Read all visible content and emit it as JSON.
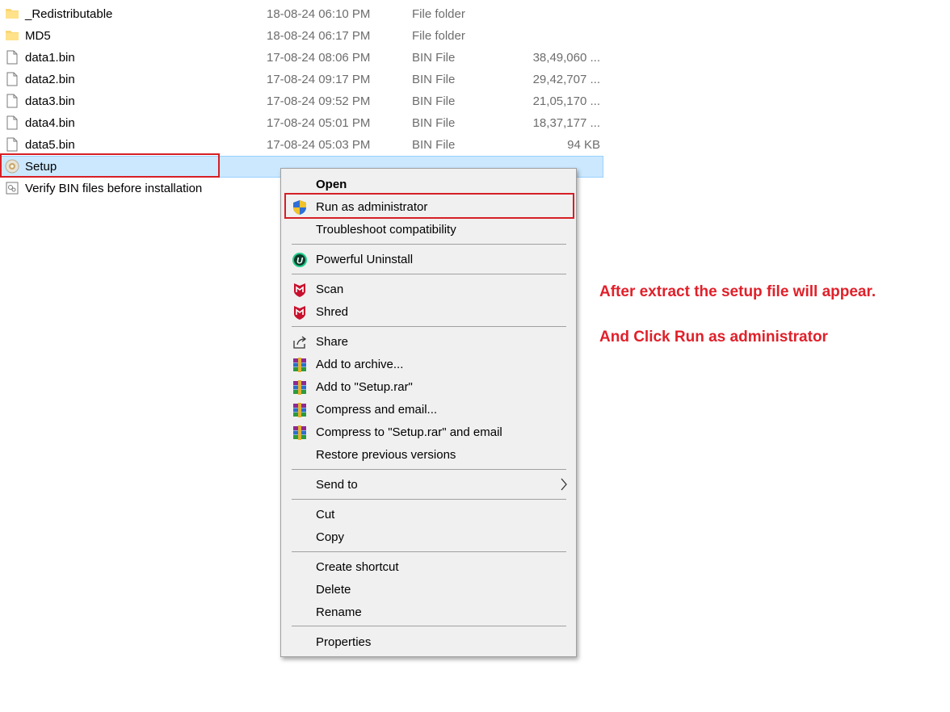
{
  "files": [
    {
      "name": "_Redistributable",
      "date": "18-08-24 06:10 PM",
      "type": "File folder",
      "size": "",
      "icon": "folder-icon"
    },
    {
      "name": "MD5",
      "date": "18-08-24 06:17 PM",
      "type": "File folder",
      "size": "",
      "icon": "folder-icon"
    },
    {
      "name": "data1.bin",
      "date": "17-08-24 08:06 PM",
      "type": "BIN File",
      "size": "38,49,060 ...",
      "icon": "file-icon"
    },
    {
      "name": "data2.bin",
      "date": "17-08-24 09:17 PM",
      "type": "BIN File",
      "size": "29,42,707 ...",
      "icon": "file-icon"
    },
    {
      "name": "data3.bin",
      "date": "17-08-24 09:52 PM",
      "type": "BIN File",
      "size": "21,05,170 ...",
      "icon": "file-icon"
    },
    {
      "name": "data4.bin",
      "date": "17-08-24 05:01 PM",
      "type": "BIN File",
      "size": "18,37,177 ...",
      "icon": "file-icon"
    },
    {
      "name": "data5.bin",
      "date": "17-08-24 05:03 PM",
      "type": "BIN File",
      "size": "94 KB",
      "icon": "file-icon"
    },
    {
      "name": "Setup",
      "icon": "setup-app-icon"
    },
    {
      "name": "Verify BIN files before installation",
      "icon": "script-file-icon"
    }
  ],
  "context_menu": {
    "open": "Open",
    "run_as_admin": "Run as administrator",
    "troubleshoot": "Troubleshoot compatibility",
    "powerful_uninstall": "Powerful Uninstall",
    "scan": "Scan",
    "shred": "Shred",
    "share": "Share",
    "add_to_archive": "Add to archive...",
    "add_to_setup_rar": "Add to \"Setup.rar\"",
    "compress_email": "Compress and email...",
    "compress_setup_rar_email": "Compress to \"Setup.rar\" and email",
    "restore_versions": "Restore previous versions",
    "send_to": "Send to",
    "cut": "Cut",
    "copy": "Copy",
    "create_shortcut": "Create shortcut",
    "delete": "Delete",
    "rename": "Rename",
    "properties": "Properties"
  },
  "annotations": {
    "line1": "After extract the setup file will appear.",
    "line2": "And Click Run as administrator"
  },
  "colors": {
    "highlight": "#d61f26",
    "selection": "#cce8ff",
    "annotation": "#e0202a"
  }
}
